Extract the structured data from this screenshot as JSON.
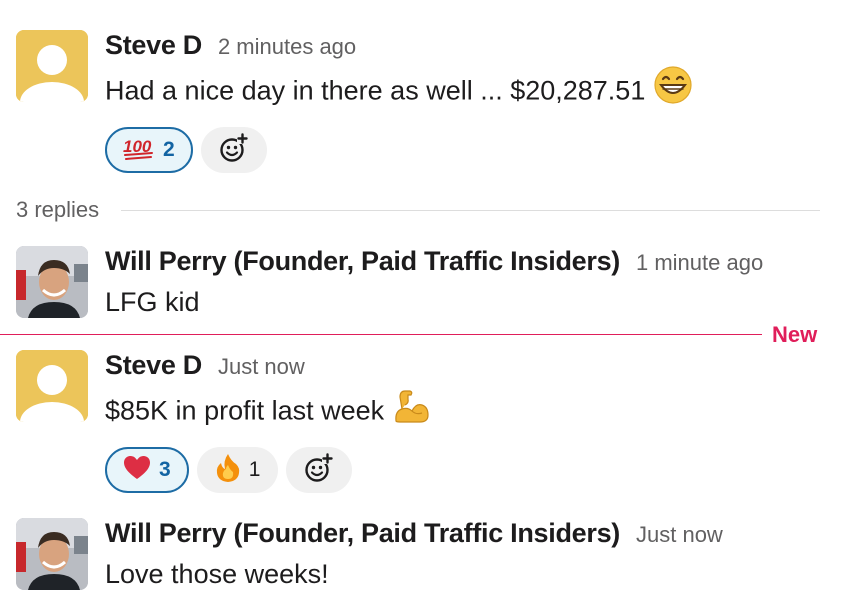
{
  "thread": {
    "replies_label": "3 replies",
    "new_label": "New"
  },
  "messages": [
    {
      "author": "Steve D",
      "time": "2 minutes ago",
      "text": "Had a nice day in there as well ... $20,287.51",
      "emoji": "grinning-face-with-smiling-eyes",
      "reactions": [
        {
          "emoji": "hundred-points",
          "count": "2",
          "mine": true
        }
      ]
    },
    {
      "author": "Will Perry (Founder, Paid Traffic Insiders)",
      "time": "1 minute ago",
      "text": "LFG kid"
    },
    {
      "author": "Steve D",
      "time": "Just now",
      "text": "$85K in profit last week",
      "emoji": "flexed-biceps",
      "reactions": [
        {
          "emoji": "red-heart",
          "count": "3",
          "mine": true
        },
        {
          "emoji": "fire",
          "count": "1",
          "mine": false
        }
      ]
    },
    {
      "author": "Will Perry (Founder, Paid Traffic Insiders)",
      "time": "Just now",
      "text": "Love those weeks!"
    }
  ],
  "colors": {
    "mention_blue": "#1264a3",
    "new_line": "#e01e5a",
    "avatar_default": "#ecc55a"
  },
  "icons": [
    "add-reaction-icon",
    "default-avatar-icon",
    "user-photo-avatar"
  ]
}
